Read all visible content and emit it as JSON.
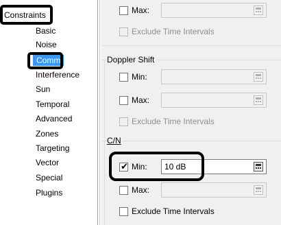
{
  "tree": {
    "root_label": "Constraints",
    "items": [
      {
        "label": "Basic"
      },
      {
        "label": "Noise"
      },
      {
        "label": "Comm",
        "selected": true
      },
      {
        "label": "Interference"
      },
      {
        "label": "Sun"
      },
      {
        "label": "Temporal"
      },
      {
        "label": "Advanced"
      },
      {
        "label": "Zones"
      },
      {
        "label": "Targeting"
      },
      {
        "label": "Vector"
      },
      {
        "label": "Special"
      },
      {
        "label": "Plugins"
      }
    ]
  },
  "panel": {
    "top_group": {
      "max_label": "Max:",
      "max_checked": false,
      "exclude_label": "Exclude Time Intervals"
    },
    "doppler": {
      "title": "Doppler Shift",
      "min_label": "Min:",
      "min_checked": false,
      "max_label": "Max:",
      "max_checked": false,
      "exclude_label": "Exclude Time Intervals"
    },
    "cn": {
      "title": "C/N",
      "min_label": "Min:",
      "min_checked": true,
      "min_value": "10 dB",
      "max_label": "Max:",
      "max_checked": false,
      "exclude_label": "Exclude Time Intervals",
      "exclude_checked": false
    }
  },
  "colors": {
    "selection": "#3399ff",
    "callout": "#000000",
    "panel_bg": "#f0f0f0"
  },
  "icons": {
    "field_button": "units-calculator-icon",
    "checkmark": "check-icon"
  }
}
